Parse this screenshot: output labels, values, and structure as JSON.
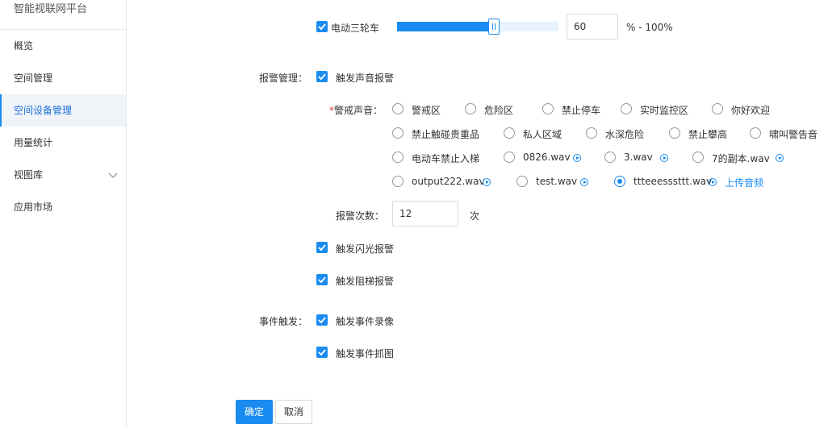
{
  "sidebar": {
    "brand": "智能视联网平台",
    "items": [
      {
        "label": "概览"
      },
      {
        "label": "空间管理"
      },
      {
        "label": "空间设备管理"
      },
      {
        "label": "用量统计"
      },
      {
        "label": "视图库"
      },
      {
        "label": "应用市场"
      }
    ]
  },
  "detection": {
    "tricycle_label": "电动三轮车",
    "tricycle_checked": true,
    "threshold_value": "60",
    "threshold_fraction": 0.6,
    "range_suffix": "% - 100%"
  },
  "alarm": {
    "section_label": "报警管理：",
    "sound_label": "触发声音报警",
    "sound_field_required": "*",
    "sound_field_label": "警戒声音：",
    "sounds": [
      {
        "label": "警戒区",
        "playable": false
      },
      {
        "label": "危险区",
        "playable": false
      },
      {
        "label": "禁止停车",
        "playable": false
      },
      {
        "label": "实时监控区",
        "playable": false
      },
      {
        "label": "你好欢迎",
        "playable": false
      },
      {
        "label": "禁止触碰贵重品",
        "playable": false
      },
      {
        "label": "私人区域",
        "playable": false
      },
      {
        "label": "水深危险",
        "playable": false
      },
      {
        "label": "禁止攀高",
        "playable": false
      },
      {
        "label": "啸叫警告音",
        "playable": false
      },
      {
        "label": "电动车禁止入梯",
        "playable": false
      },
      {
        "label": "0826.wav",
        "playable": true
      },
      {
        "label": "3.wav",
        "playable": true
      },
      {
        "label": "7的副本.wav",
        "playable": true
      },
      {
        "label": "output222.wav",
        "playable": true
      },
      {
        "label": "test.wav",
        "playable": true
      },
      {
        "label": "ttteeesssttt.wav",
        "playable": true
      }
    ],
    "selected_sound": "ttteeesssttt.wav",
    "upload_link": "上传音频",
    "count_label": "报警次数：",
    "count_value": "12",
    "count_unit": "次",
    "flash_label": "触发闪光报警",
    "stair_label": "触发阻梯报警"
  },
  "event": {
    "section_label": "事件触发：",
    "record_label": "触发事件录像",
    "snapshot_label": "触发事件抓图"
  },
  "actions": {
    "confirm_label": "确定",
    "cancel_label": "取消"
  },
  "colors": {
    "accent": "#1a8bf0",
    "required": "#e4393c"
  }
}
